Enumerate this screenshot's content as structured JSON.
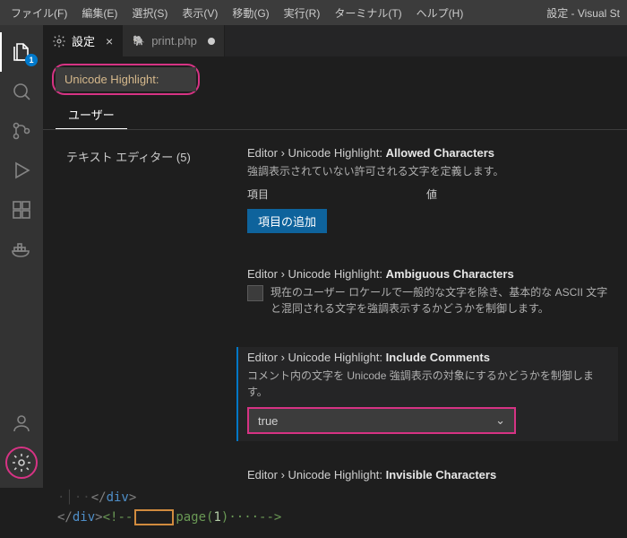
{
  "menubar": {
    "items": [
      "ファイル(F)",
      "編集(E)",
      "選択(S)",
      "表示(V)",
      "移動(G)",
      "実行(R)",
      "ターミナル(T)",
      "ヘルプ(H)"
    ],
    "title": "設定 - Visual St"
  },
  "activitybar": {
    "explorer_badge": "1"
  },
  "tabs": {
    "settings": {
      "label": "設定"
    },
    "file": {
      "label": "print.php"
    }
  },
  "search": {
    "value": "Unicode Highlight:"
  },
  "scope_tabs": {
    "user": "ユーザー"
  },
  "toc": {
    "text_editor": "テキスト エディター (5)"
  },
  "settings": {
    "allowed": {
      "path": "Editor › Unicode Highlight: ",
      "name": "Allowed Characters",
      "desc": "強調表示されていない許可される文字を定義します。",
      "col_key": "項目",
      "col_val": "値",
      "add_btn": "項目の追加"
    },
    "ambiguous": {
      "path": "Editor › Unicode Highlight: ",
      "name": "Ambiguous Characters",
      "desc": "現在のユーザー ロケールで一般的な文字を除き、基本的な ASCII 文字と混同される文字を強調表示するかどうかを制御します。"
    },
    "include_comments": {
      "path": "Editor › Unicode Highlight: ",
      "name": "Include Comments",
      "desc": "コメント内の文字を Unicode 強調表示の対象にするかどうかを制御します。",
      "value": "true"
    },
    "invisible": {
      "path": "Editor › Unicode Highlight: ",
      "name": "Invisible Characters"
    }
  },
  "code": {
    "line1": {
      "tag": "div"
    },
    "line2": {
      "tag": "div",
      "comment_func": "page",
      "comment_arg": "1"
    }
  }
}
